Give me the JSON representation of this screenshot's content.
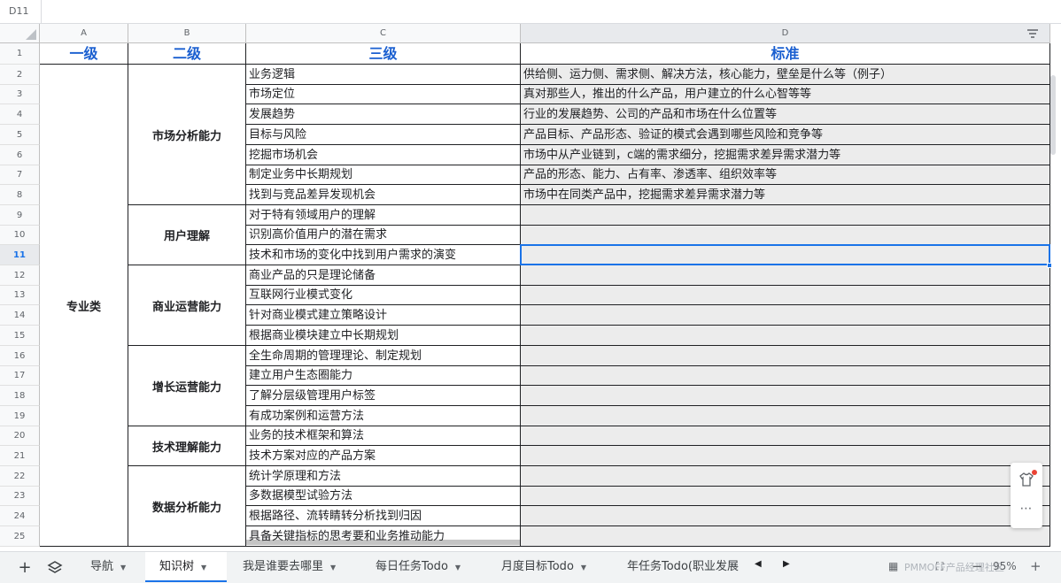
{
  "namebox": "D11",
  "columns": [
    "A",
    "B",
    "C",
    "D"
  ],
  "header": {
    "level1": "一级",
    "level2": "二级",
    "level3": "三级",
    "standard": "标准"
  },
  "row_numbers": [
    "1",
    "2",
    "3",
    "4",
    "5",
    "6",
    "7",
    "8",
    "9",
    "10",
    "11",
    "12",
    "13",
    "14",
    "15",
    "16",
    "17",
    "18",
    "19",
    "20",
    "21",
    "22",
    "23",
    "24",
    "25"
  ],
  "level1_group": "专业类",
  "level2_groups": [
    "市场分析能力",
    "用户理解",
    "商业运营能力",
    "增长运营能力",
    "技术理解能力",
    "数据分析能力"
  ],
  "level3_items": [
    "业务逻辑",
    "市场定位",
    "发展趋势",
    "目标与风险",
    "挖掘市场机会",
    "制定业务中长期规划",
    "找到与竞品差异发现机会",
    "对于特有领域用户的理解",
    "识别高价值用户的潜在需求",
    "技术和市场的变化中找到用户需求的演变",
    "商业产品的只是理论储备",
    "互联网行业模式变化",
    "针对商业模式建立策略设计",
    "根据商业模块建立中长期规划",
    "全生命周期的管理理论、制定规划",
    "建立用户生态圈能力",
    "了解分层级管理用户标签",
    "有成功案例和运营方法",
    "业务的技术框架和算法",
    "技术方案对应的产品方案",
    "统计学原理和方法",
    "多数据模型试验方法",
    "根据路径、流转睛转分析找到归因",
    "具备关键指标的思考要和业务推动能力"
  ],
  "standards": [
    "供给侧、运力侧、需求侧、解决方法，核心能力，壁垒是什么等（例子）",
    "真对那些人，推出的什么产品，用户建立的什么心智等等",
    "行业的发展趋势、公司的产品和市场在什么位置等",
    "产品目标、产品形态、验证的模式会遇到哪些风险和竞争等",
    "市场中从产业链到，c端的需求细分，挖掘需求差异需求潜力等",
    "产品的形态、能力、占有率、渗透率、组织效率等",
    "市场中在同类产品中，挖掘需求差异需求潜力等",
    "",
    "",
    "",
    "",
    "",
    "",
    "",
    "",
    "",
    "",
    "",
    "",
    "",
    "",
    "",
    "",
    ""
  ],
  "sheet_tabs": [
    "导航",
    "知识树",
    "我是谁要去哪里",
    "每日任务Todo",
    "月度目标Todo",
    "年任务Todo(职业发展"
  ],
  "active_tab": "知识树",
  "status": {
    "zoom": "95%",
    "watermark": "PMMOFF产品经理社区"
  },
  "colors": {
    "header_blue": "#1a5fd0",
    "selection": "#1a73e8",
    "d_fill": "#ececec"
  }
}
